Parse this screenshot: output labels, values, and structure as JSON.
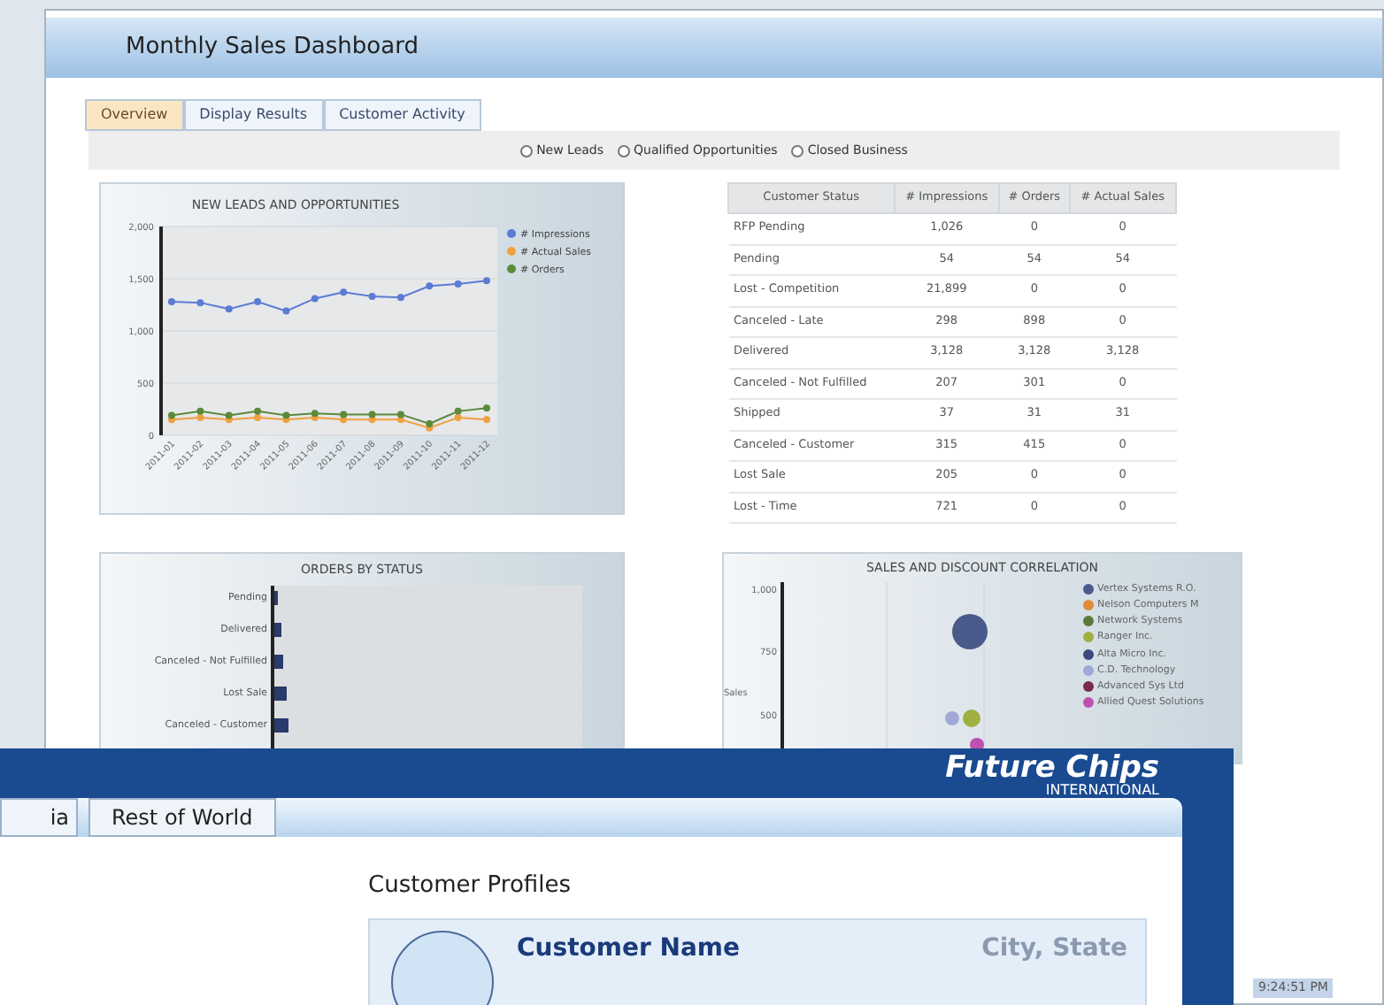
{
  "back_window": {
    "title": "Monthly Sales Dashboard",
    "tabs": [
      {
        "label": "Overview",
        "selected": true
      },
      {
        "label": "Display Results",
        "selected": false
      },
      {
        "label": "Customer Activity",
        "selected": false
      }
    ],
    "radios": [
      {
        "label": "New Leads",
        "selected": false
      },
      {
        "label": "Qualified Opportunities",
        "selected": false
      },
      {
        "label": "Closed Business",
        "selected": false
      }
    ],
    "line_chart": {
      "chart_data": {
        "type": "line",
        "title": "NEW LEADS AND OPPORTUNITIES",
        "grid": true,
        "legend": "right",
        "categories": [
          "2011-01",
          "2011-02",
          "2011-03",
          "2011-04",
          "2011-05",
          "2011-06",
          "2011-07",
          "2011-08",
          "2011-09",
          "2011-10",
          "2011-11",
          "2011-12"
        ],
        "yticks": [
          {
            "value": 0,
            "label": "0"
          },
          {
            "value": 500,
            "label": "500"
          },
          {
            "value": 1000,
            "label": "1,000"
          },
          {
            "value": 1500,
            "label": "1,500"
          },
          {
            "value": 2000,
            "label": "2,000"
          }
        ],
        "ylim": [
          0,
          2000
        ],
        "series": [
          {
            "name": "# Impressions",
            "color": "#5b7bd5",
            "marker": "circle",
            "values": [
              1280,
              1270,
              1210,
              1280,
              1190,
              1310,
              1370,
              1330,
              1320,
              1430,
              1450,
              1480
            ]
          },
          {
            "name": "# Actual Sales",
            "color": "#f0a040",
            "marker": "circle",
            "values": [
              150,
              170,
              150,
              170,
              150,
              170,
              150,
              150,
              150,
              70,
              170,
              150
            ]
          },
          {
            "name": "# Orders",
            "color": "#5a8a3a",
            "marker": "circle",
            "values": [
              190,
              230,
              190,
              230,
              190,
              210,
              200,
              200,
              200,
              110,
              230,
              260
            ]
          }
        ]
      }
    },
    "status_table": {
      "columns": [
        "Customer Status",
        "# Impressions",
        "# Orders",
        "# Actual Sales"
      ],
      "rows": [
        [
          "RFP Pending",
          "1,026",
          "0",
          "0"
        ],
        [
          "Pending",
          "54",
          "54",
          "54"
        ],
        [
          "Lost - Competition",
          "21,899",
          "0",
          "0"
        ],
        [
          "Canceled - Late",
          "298",
          "898",
          "0"
        ],
        [
          "Delivered",
          "3,128",
          "3,128",
          "3,128"
        ],
        [
          "Canceled - Not Fulfilled",
          "207",
          "301",
          "0"
        ],
        [
          "Shipped",
          "37",
          "31",
          "31"
        ],
        [
          "Canceled - Customer",
          "315",
          "415",
          "0"
        ],
        [
          "Lost Sale",
          "205",
          "0",
          "0"
        ],
        [
          "Lost - Time",
          "721",
          "0",
          "0"
        ]
      ]
    },
    "bar_chart": {
      "title": "ORDERS BY STATUS",
      "categories": [
        "Pending",
        "Delivered",
        "Canceled - Not Fulfilled",
        "Lost Sale",
        "Canceled - Customer"
      ]
    },
    "scatter_chart": {
      "title": "SALES AND DISCOUNT CORRELATION",
      "y_tick_labels": [
        "1,000",
        "750",
        "500"
      ],
      "y_axis_label": "Sales",
      "legend": [
        {
          "label": "Vertex Systems R.O.",
          "color": "#4a5a8a"
        },
        {
          "label": "Nelson Computers M",
          "color": "#e08a3a"
        },
        {
          "label": "Network Systems",
          "color": "#5a7a3a"
        },
        {
          "label": "Ranger Inc.",
          "color": "#a0b040"
        },
        {
          "label": "Alta Micro Inc.",
          "color": "#3a4a80"
        },
        {
          "label": "C.D. Technology",
          "color": "#a0a8d8"
        },
        {
          "label": "Advanced Sys Ltd",
          "color": "#7a2a50"
        },
        {
          "label": "Allied Quest Solutions",
          "color": "#c050b0"
        }
      ]
    },
    "clock": "9:24:51 PM"
  },
  "front_window": {
    "logo": {
      "name": "Future Chips",
      "sub": "INTERNATIONAL"
    },
    "region_buttons": [
      "ia",
      "Rest of World"
    ],
    "section_title": "Customer Profiles",
    "profile_card": {
      "name": "Customer Name",
      "location": "City, State"
    }
  }
}
